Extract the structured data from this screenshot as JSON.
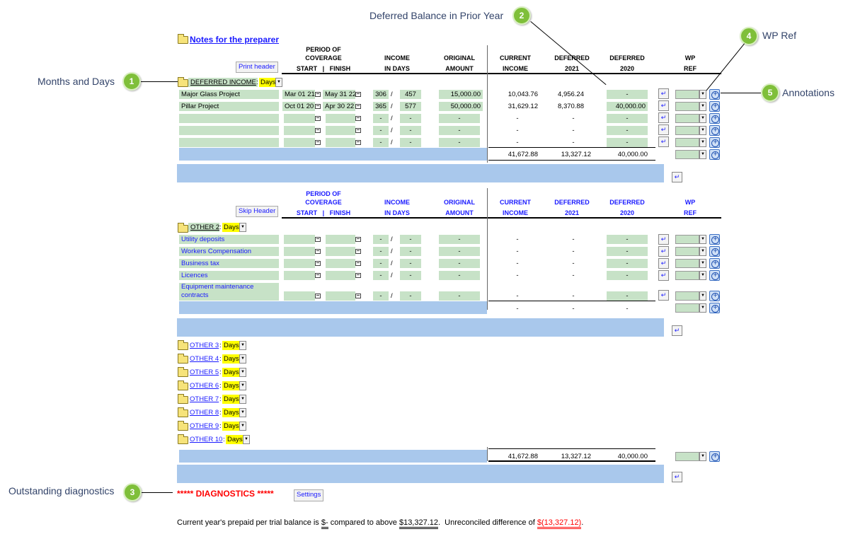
{
  "callouts": {
    "c1": {
      "num": "1",
      "text": "Months and Days"
    },
    "c2": {
      "num": "2",
      "text": "Deferred Balance in Prior Year"
    },
    "c3": {
      "num": "3",
      "text": "Outstanding diagnostics"
    },
    "c4": {
      "num": "4",
      "text": "WP Ref"
    },
    "c5": {
      "num": "5",
      "text": "Annotations"
    }
  },
  "notes_link": "Notes for the preparer",
  "header1": {
    "button": "Print header",
    "period": "PERIOD OF",
    "coverage": "COVERAGE",
    "start_finish": "START   |   FINISH",
    "income": "INCOME",
    "in_days": "IN DAYS",
    "original": "ORIGINAL",
    "amount": "AMOUNT",
    "current": "CURRENT",
    "current_income": "INCOME",
    "deferred": "DEFERRED",
    "y2021": "2021",
    "y2020": "2020",
    "wp": "WP",
    "ref": "REF"
  },
  "header2": {
    "button": "Skip Header",
    "period": "PERIOD OF",
    "coverage": "COVERAGE",
    "start_finish": "START   |   FINISH",
    "income": "INCOME",
    "in_days": "IN DAYS",
    "original": "ORIGINAL",
    "amount": "AMOUNT",
    "current": "CURRENT",
    "current_income": "INCOME",
    "deferred": "DEFERRED",
    "y2021": "2021",
    "y2020": "2020",
    "wp": "WP",
    "ref": "REF"
  },
  "section1": {
    "label": "DEFERRED INCOME",
    "sep": ":",
    "days": "Days",
    "rows": [
      {
        "name": "Major Glass Project",
        "start": "Mar 01 21",
        "finish": "May 31 22",
        "days": "306",
        "total_days": "457",
        "original": "15,000.00",
        "current": "10,043.76",
        "d2021": "4,956.24",
        "d2020": "-"
      },
      {
        "name": "Pillar Project",
        "start": "Oct 01 20",
        "finish": "Apr 30 22",
        "days": "365",
        "total_days": "577",
        "original": "50,000.00",
        "current": "31,629.12",
        "d2021": "8,370.88",
        "d2020": "40,000.00"
      },
      {
        "name": "",
        "start": "",
        "finish": "",
        "days": "-",
        "total_days": "-",
        "original": "-",
        "current": "-",
        "d2021": "-",
        "d2020": "-"
      },
      {
        "name": "",
        "start": "",
        "finish": "",
        "days": "-",
        "total_days": "-",
        "original": "-",
        "current": "-",
        "d2021": "-",
        "d2020": "-"
      },
      {
        "name": "",
        "start": "",
        "finish": "",
        "days": "-",
        "total_days": "-",
        "original": "-",
        "current": "-",
        "d2021": "-",
        "d2020": "-"
      }
    ],
    "totals": {
      "current": "41,672.88",
      "d2021": "13,327.12",
      "d2020": "40,000.00"
    }
  },
  "section2": {
    "label": "OTHER 2",
    "sep": ":",
    "days": "Days",
    "rows": [
      {
        "name": "Utility deposits",
        "days": "-",
        "total_days": "-",
        "original": "-",
        "current": "-",
        "d2021": "-",
        "d2020": "-"
      },
      {
        "name": "Workers Compensation",
        "days": "-",
        "total_days": "-",
        "original": "-",
        "current": "-",
        "d2021": "-",
        "d2020": "-"
      },
      {
        "name": "Business tax",
        "days": "-",
        "total_days": "-",
        "original": "-",
        "current": "-",
        "d2021": "-",
        "d2020": "-"
      },
      {
        "name": "Licences",
        "days": "-",
        "total_days": "-",
        "original": "-",
        "current": "-",
        "d2021": "-",
        "d2020": "-"
      },
      {
        "name": "Equipment maintenance contracts",
        "days": "-",
        "total_days": "-",
        "original": "-",
        "current": "-",
        "d2021": "-",
        "d2020": "-"
      }
    ],
    "totals": {
      "current": "-",
      "d2021": "-",
      "d2020": "-"
    }
  },
  "other_sections": [
    {
      "label": "OTHER 3",
      "days": "Days"
    },
    {
      "label": "OTHER 4",
      "days": "Days"
    },
    {
      "label": "OTHER 5",
      "days": "Days"
    },
    {
      "label": "OTHER 6",
      "days": "Days"
    },
    {
      "label": "OTHER 7",
      "days": "Days"
    },
    {
      "label": "OTHER 8",
      "days": "Days"
    },
    {
      "label": "OTHER 9",
      "days": "Days"
    },
    {
      "label": "OTHER 10",
      "days": "Days"
    }
  ],
  "grand_totals": {
    "current": "41,672.88",
    "d2021": "13,327.12",
    "d2020": "40,000.00"
  },
  "diagnostics": {
    "title": "***** DIAGNOSTICS *****",
    "settings": "Settings",
    "msg1": "Current year's prepaid per trial balance is ",
    "tb": "$-",
    "msg2": " compared to above ",
    "above": "$13,327.12",
    "msg3": ".  Unreconciled difference of ",
    "diff": "$(13,327.12)",
    "msg4": "."
  },
  "colors": {
    "green_field": "#c7e2c7",
    "blue_bar": "#a9c8ec",
    "header_blue": "#1a1aff",
    "diag_red": "#ff0000",
    "badge": "#7fbf3a"
  },
  "icons": [
    "folder-icon",
    "calendar-icon",
    "note-icon",
    "add-annotation-icon",
    "dropdown-arrow-icon"
  ]
}
